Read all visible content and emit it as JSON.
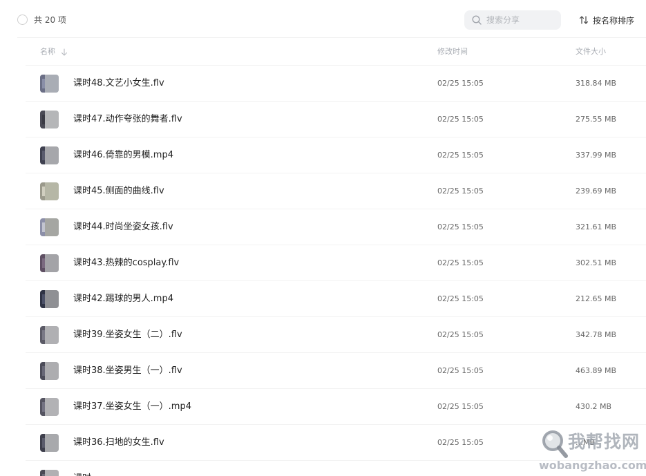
{
  "toolbar": {
    "total_label": "共 20 项",
    "search_placeholder": "搜索分享",
    "sort_label": "按名称排序"
  },
  "table": {
    "columns": {
      "name": "名称",
      "modified": "修改时间",
      "size": "文件大小"
    },
    "rows": [
      {
        "name": "课时48.文艺小女生.flv",
        "modified": "02/25 15:05",
        "size": "318.84 MB",
        "thumb": [
          "#6b6f86",
          "#a9adb5",
          "#8a8fa8"
        ]
      },
      {
        "name": "课时47.动作夸张的舞者.flv",
        "modified": "02/25 15:05",
        "size": "275.55 MB",
        "thumb": [
          "#4a4a55",
          "#b5b6b8",
          "#3a3a44"
        ]
      },
      {
        "name": "课时46.倚靠的男模.mp4",
        "modified": "02/25 15:05",
        "size": "337.99 MB",
        "thumb": [
          "#3f4150",
          "#a6a7ab",
          "#5a5c6e"
        ]
      },
      {
        "name": "课时45.侧面的曲线.flv",
        "modified": "02/25 15:05",
        "size": "239.69 MB",
        "thumb": [
          "#9b9a8c",
          "#b6b7a6",
          "#d1cfc0"
        ]
      },
      {
        "name": "课时44.时尚坐姿女孩.flv",
        "modified": "02/25 15:05",
        "size": "321.61 MB",
        "thumb": [
          "#8c8fa8",
          "#a5a6a2",
          "#c2c4d0"
        ]
      },
      {
        "name": "课时43.热辣的cosplay.flv",
        "modified": "02/25 15:05",
        "size": "302.51 MB",
        "thumb": [
          "#5e4f63",
          "#a3a3a7",
          "#7b6a80"
        ]
      },
      {
        "name": "课时42.踢球的男人.mp4",
        "modified": "02/25 15:05",
        "size": "212.65 MB",
        "thumb": [
          "#2f3345",
          "#8f9094",
          "#4c5168"
        ]
      },
      {
        "name": "课时39.坐姿女生（二）.flv",
        "modified": "02/25 15:05",
        "size": "342.78 MB",
        "thumb": [
          "#5b5a66",
          "#b0b0b3",
          "#7a7986"
        ]
      },
      {
        "name": "课时38.坐姿男生（一）.flv",
        "modified": "02/25 15:05",
        "size": "463.89 MB",
        "thumb": [
          "#4c4c59",
          "#adadb0",
          "#686877"
        ]
      },
      {
        "name": "课时37.坐姿女生（一）.mp4",
        "modified": "02/25 15:05",
        "size": "430.2 MB",
        "thumb": [
          "#555461",
          "#b2b2b5",
          "#747383"
        ]
      },
      {
        "name": "课时36.扫地的女生.flv",
        "modified": "02/25 15:05",
        "size": "…MB",
        "thumb": [
          "#3e3f4c",
          "#a8a9ac",
          "#5b5c6c"
        ]
      },
      {
        "name": "课时…",
        "modified": "",
        "size": "",
        "thumb": [
          "#4a4a55",
          "#b0b0b3",
          "#6a6a77"
        ]
      }
    ]
  },
  "watermark": {
    "brand": "我帮找网",
    "url": "wobangzhao.com"
  },
  "colors": {
    "accent_search_bg": "#f1f2f4",
    "divider": "#f2f2f2",
    "header_text": "#a8acb3"
  }
}
